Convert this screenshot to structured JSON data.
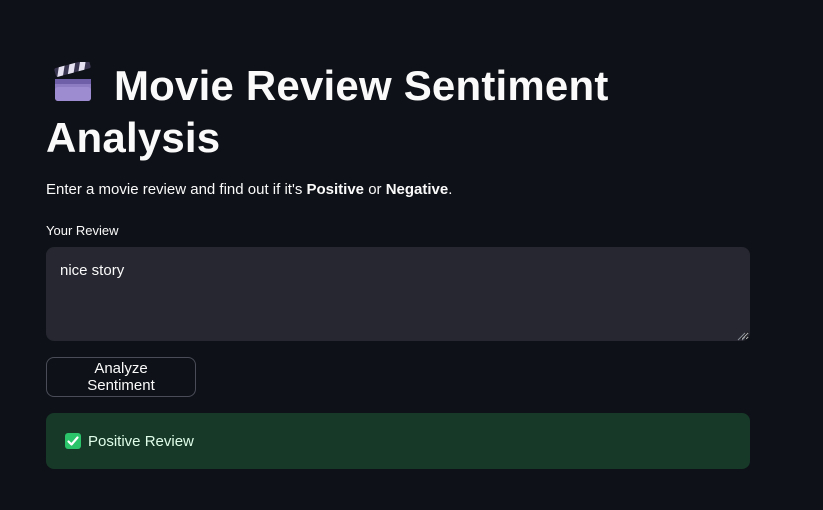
{
  "header": {
    "title": "Movie Review Sentiment Analysis",
    "title_icon": "clapper-board-icon"
  },
  "intro": {
    "prefix": "Enter a movie review and find out if it's ",
    "positive_word": "Positive",
    "middle": " or ",
    "negative_word": "Negative",
    "suffix": "."
  },
  "review_input": {
    "label": "Your Review",
    "value": "nice story"
  },
  "analyze_button": {
    "label": "Analyze Sentiment"
  },
  "result": {
    "icon": "check-mark-icon",
    "text": "Positive Review",
    "status_color": "#173928"
  },
  "colors": {
    "background": "#0e1117",
    "input_background": "#262730",
    "success_background": "#173928",
    "success_text": "#dffde9",
    "check_green": "#2bc46b"
  }
}
